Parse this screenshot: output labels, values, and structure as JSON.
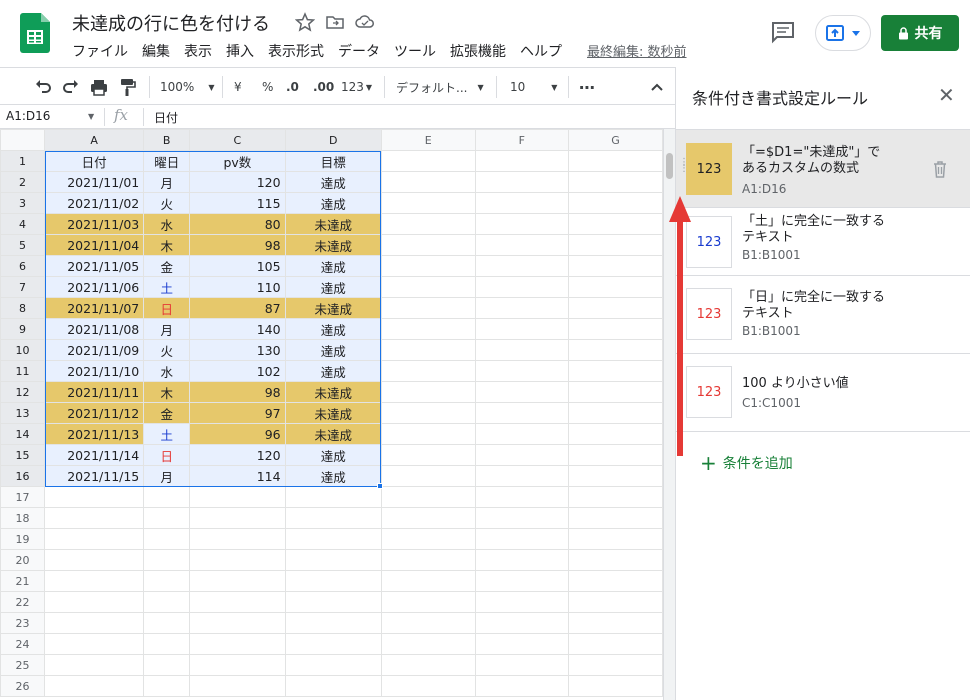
{
  "header": {
    "doc_title": "未達成の行に色を付ける",
    "menu": [
      "ファイル",
      "編集",
      "表示",
      "挿入",
      "表示形式",
      "データ",
      "ツール",
      "拡張機能",
      "ヘルプ"
    ],
    "last_edit": "最終編集: 数秒前",
    "share_label": "共有"
  },
  "toolbar": {
    "zoom": "100%",
    "currency": "¥",
    "percent": "%",
    "dec_less": ".0",
    "dec_more": ".00",
    "format_more": "123",
    "font": "デフォルト...",
    "font_size": "10",
    "more": "⋯"
  },
  "formula_bar": {
    "name_box": "A1:D16",
    "fx": "fx",
    "value": "日付"
  },
  "grid": {
    "columns": [
      "A",
      "B",
      "C",
      "D",
      "E",
      "F",
      "G"
    ],
    "row_numbers": [
      "1",
      "2",
      "3",
      "4",
      "5",
      "6",
      "7",
      "8",
      "9",
      "10",
      "11",
      "12",
      "13",
      "14",
      "15",
      "16",
      "17",
      "18",
      "19",
      "20",
      "21",
      "22",
      "23",
      "24",
      "25",
      "26"
    ],
    "headers": [
      "日付",
      "曜日",
      "pv数",
      "目標"
    ],
    "rows": [
      [
        "2021/11/01",
        "月",
        "120",
        "達成"
      ],
      [
        "2021/11/02",
        "火",
        "115",
        "達成"
      ],
      [
        "2021/11/03",
        "水",
        "80",
        "未達成"
      ],
      [
        "2021/11/04",
        "木",
        "98",
        "未達成"
      ],
      [
        "2021/11/05",
        "金",
        "105",
        "達成"
      ],
      [
        "2021/11/06",
        "土",
        "110",
        "達成"
      ],
      [
        "2021/11/07",
        "日",
        "87",
        "未達成"
      ],
      [
        "2021/11/08",
        "月",
        "140",
        "達成"
      ],
      [
        "2021/11/09",
        "火",
        "130",
        "達成"
      ],
      [
        "2021/11/10",
        "水",
        "102",
        "達成"
      ],
      [
        "2021/11/11",
        "木",
        "98",
        "未達成"
      ],
      [
        "2021/11/12",
        "金",
        "97",
        "未達成"
      ],
      [
        "2021/11/13",
        "土",
        "96",
        "未達成"
      ],
      [
        "2021/11/14",
        "日",
        "120",
        "達成"
      ],
      [
        "2021/11/15",
        "月",
        "114",
        "達成"
      ]
    ]
  },
  "side_panel": {
    "title": "条件付き書式設定ルール",
    "rules": [
      {
        "preview": "123",
        "description": "「=$D1=\"未達成\"」であるカスタムの数式",
        "range": "A1:D16"
      },
      {
        "preview": "123",
        "description": "「土」に完全に一致するテキスト",
        "range": "B1:B1001"
      },
      {
        "preview": "123",
        "description": "「日」に完全に一致するテキスト",
        "range": "B1:B1001"
      },
      {
        "preview": "123",
        "description": "100 より小さい値",
        "range": "C1:C1001"
      }
    ],
    "add_rule": "条件を追加"
  },
  "colors": {
    "highlight": "#e6c86b",
    "selection_tint": "#e8f0fe",
    "selection_border": "#1a73e8",
    "share_green": "#188038",
    "annotation_red": "#e53935",
    "saturday_blue": "#1a3ccf",
    "sunday_red": "#e53935"
  }
}
